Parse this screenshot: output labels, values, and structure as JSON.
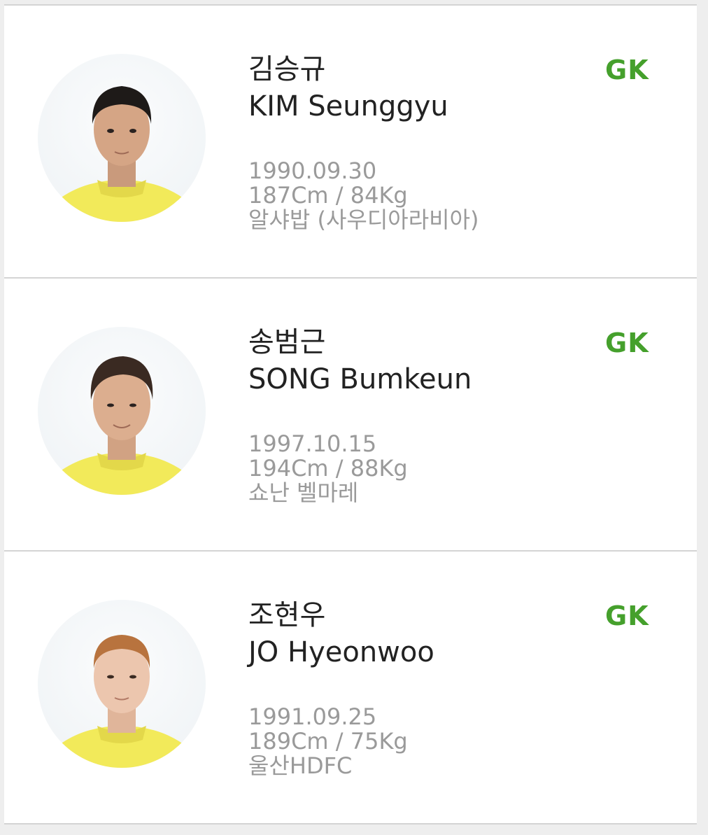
{
  "players": [
    {
      "name_ko": "김승규",
      "name_en": "KIM Seunggyu",
      "position": "GK",
      "birth": "1990.09.30",
      "body": "187Cm / 84Kg",
      "club": "알샤밥 (사우디아라비아)",
      "photo": "player-photo",
      "hair_color": "#1e1a18"
    },
    {
      "name_ko": "송범근",
      "name_en": "SONG Bumkeun",
      "position": "GK",
      "birth": "1997.10.15",
      "body": "194Cm / 88Kg",
      "club": "쇼난 벨마레",
      "photo": "player-photo",
      "hair_color": "#3a2a22"
    },
    {
      "name_ko": "조현우",
      "name_en": "JO Hyeonwoo",
      "position": "GK",
      "birth": "1991.09.25",
      "body": "189Cm / 75Kg",
      "club": "울산HDFC",
      "photo": "player-photo",
      "hair_color": "#b8733e"
    }
  ],
  "colors": {
    "position": "#45a02c",
    "jersey": "#f2ea5a",
    "meta_text": "#9a9a9a"
  }
}
